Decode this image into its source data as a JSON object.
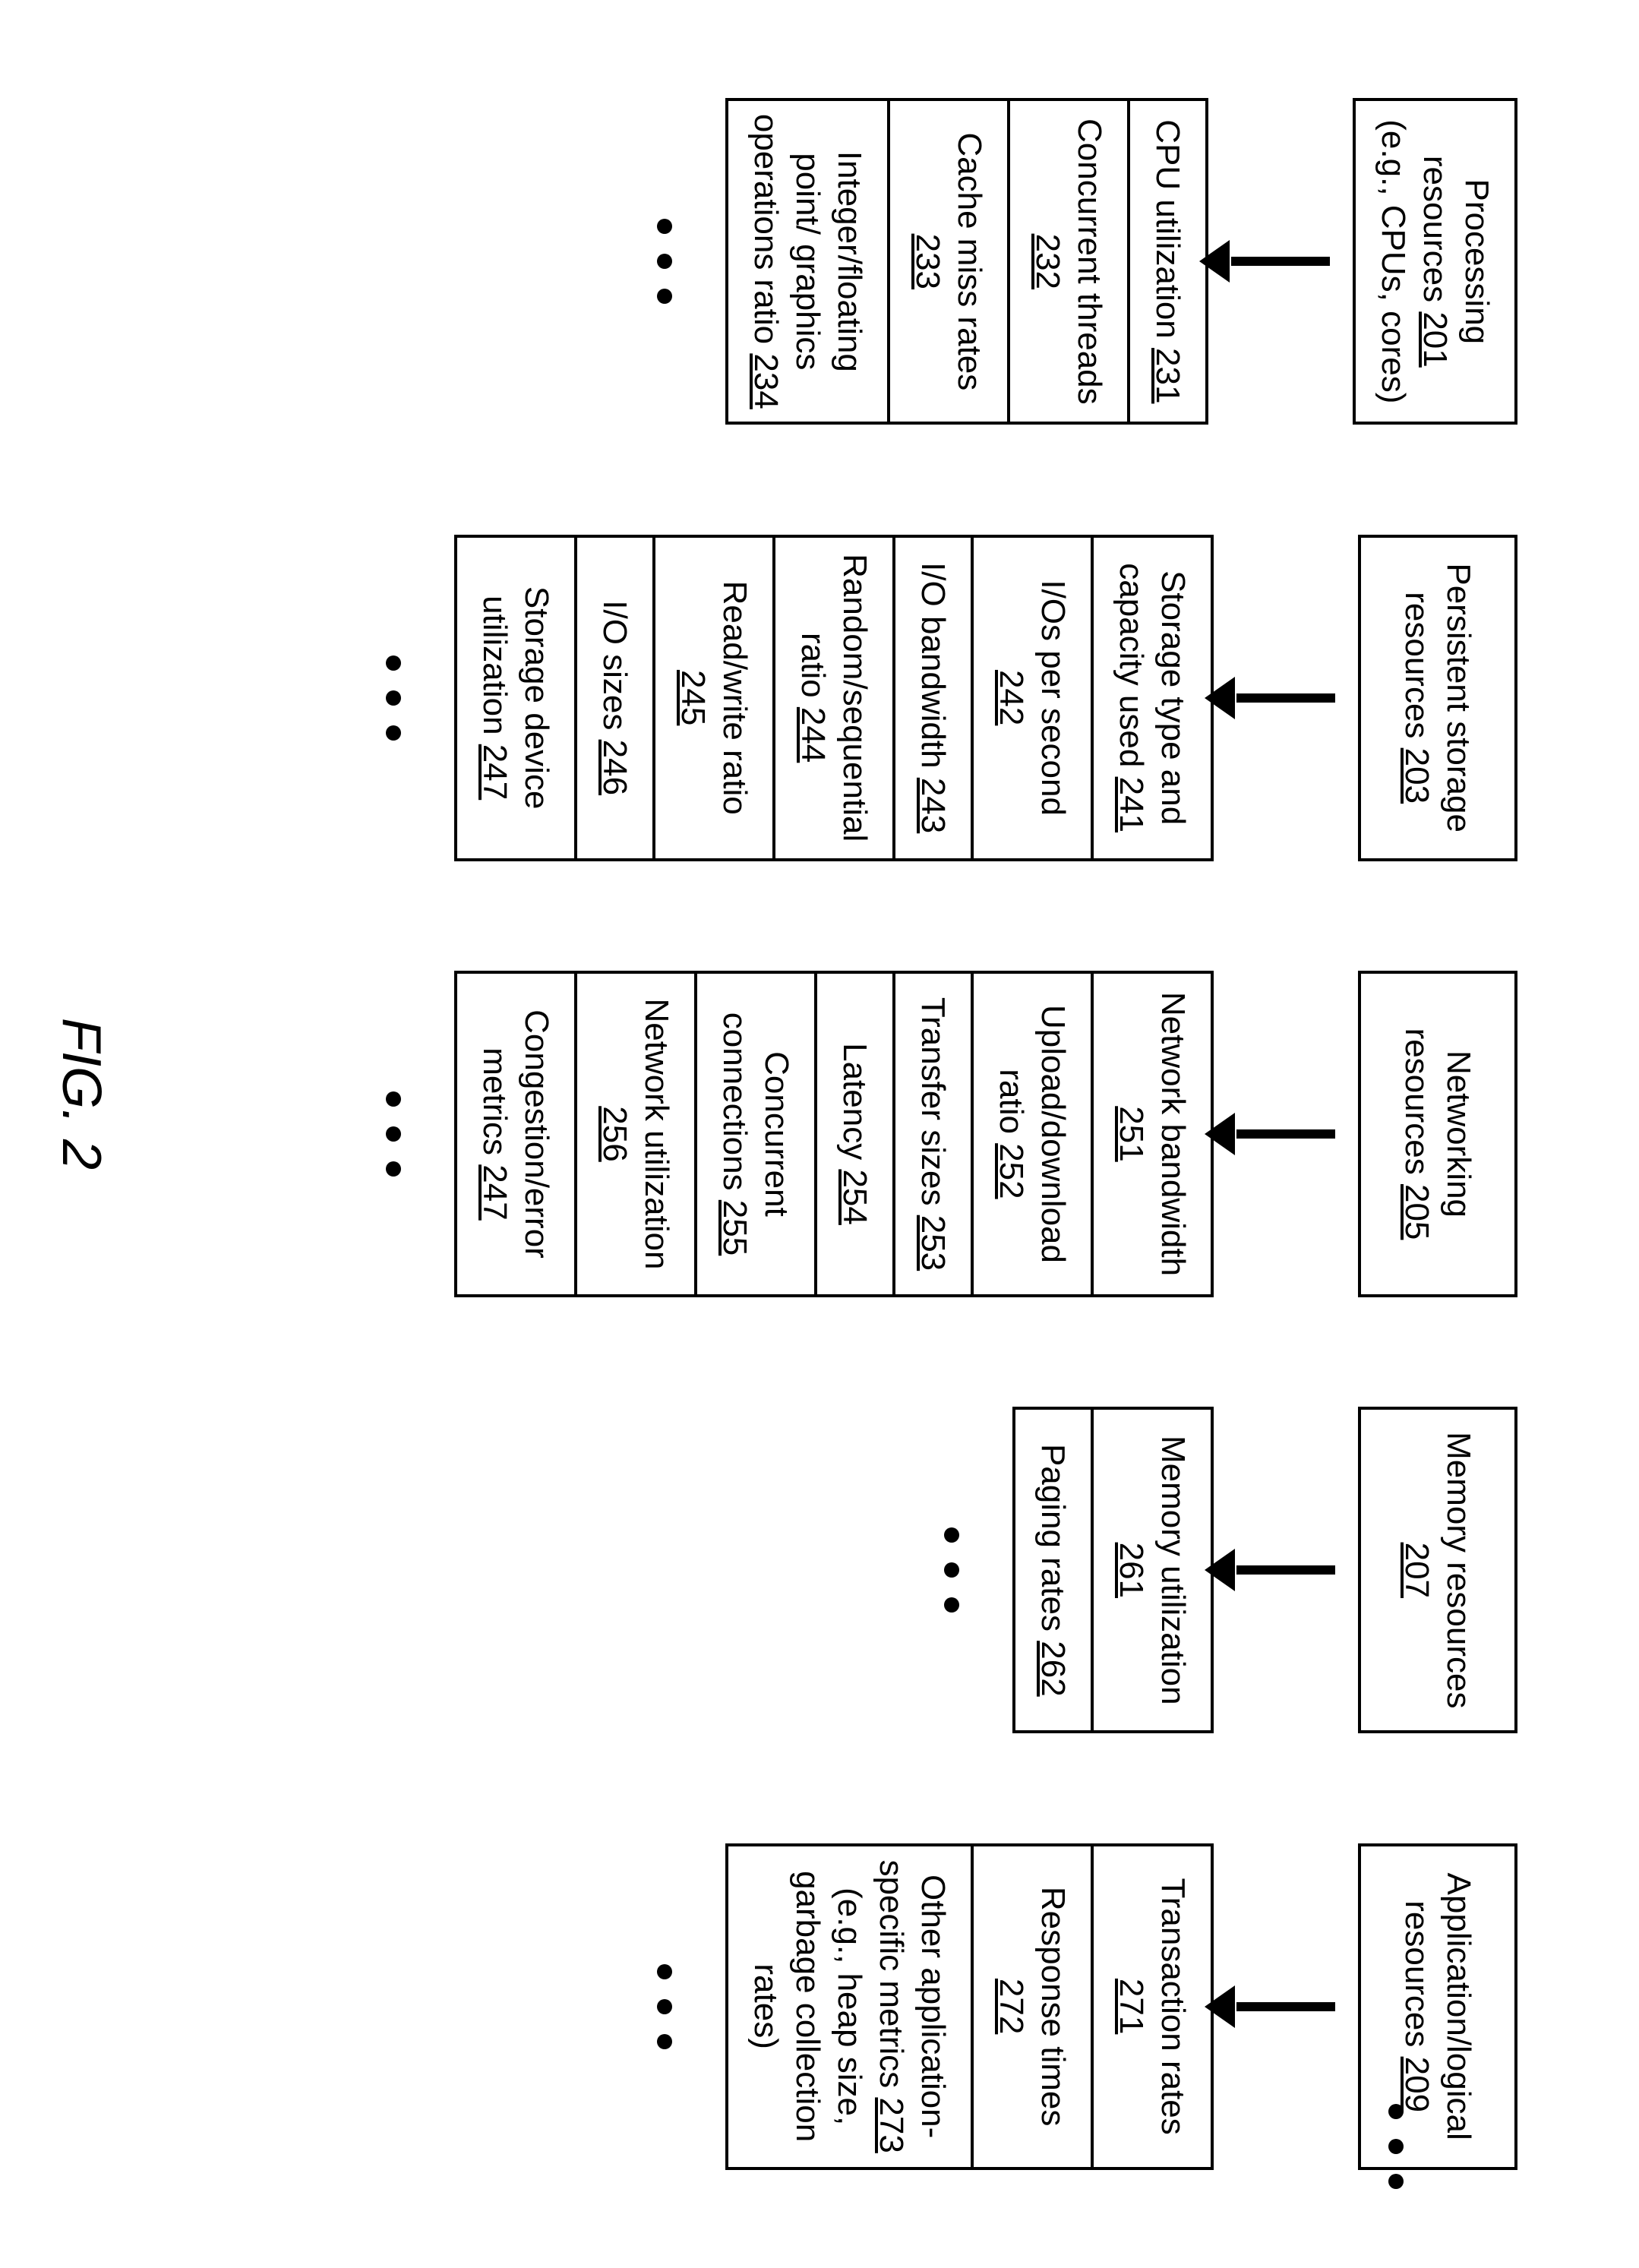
{
  "figure_label": "FIG. 2",
  "ellipsis": "• • •",
  "columns": [
    {
      "header": {
        "text": "Processing resources",
        "ref": "201",
        "suffix": " (e.g., CPUs, cores)"
      },
      "items": [
        {
          "text": "CPU utilization",
          "ref": "231"
        },
        {
          "text": "Concurrent threads",
          "ref": "232"
        },
        {
          "text": "Cache miss rates",
          "ref": "233"
        },
        {
          "text": "Integer/floating point/ graphics operations ratio",
          "ref": "234"
        }
      ]
    },
    {
      "header": {
        "text": "Persistent storage resources",
        "ref": "203"
      },
      "items": [
        {
          "text": "Storage type and capacity used",
          "ref": "241"
        },
        {
          "text": "I/Os per second",
          "ref": "242"
        },
        {
          "text": "I/O bandwidth",
          "ref": "243"
        },
        {
          "text": "Random/sequential ratio",
          "ref": "244"
        },
        {
          "text": "Read/write ratio",
          "ref": "245"
        },
        {
          "text": "I/O sizes",
          "ref": "246"
        },
        {
          "text": "Storage device utilization",
          "ref": "247"
        }
      ]
    },
    {
      "header": {
        "text": "Networking resources",
        "ref": "205"
      },
      "items": [
        {
          "text": "Network bandwidth",
          "ref": "251"
        },
        {
          "text": "Upload/download ratio",
          "ref": "252"
        },
        {
          "text": "Transfer sizes",
          "ref": "253"
        },
        {
          "text": "Latency",
          "ref": "254"
        },
        {
          "text": "Concurrent connections",
          "ref": "255"
        },
        {
          "text": "Network utilization",
          "ref": "256"
        },
        {
          "text": "Congestion/error metrics",
          "ref": "247"
        }
      ]
    },
    {
      "header": {
        "text": "Memory resources",
        "ref": "207"
      },
      "items": [
        {
          "text": "Memory utilization",
          "ref": "261"
        },
        {
          "text": "Paging rates",
          "ref": "262"
        }
      ]
    },
    {
      "header": {
        "text": "Application/logical resources",
        "ref": "209"
      },
      "items": [
        {
          "text": "Transaction rates",
          "ref": "271"
        },
        {
          "text": "Response times",
          "ref": "272"
        },
        {
          "text": "Other application-specific metrics",
          "ref": "273",
          "suffix": " (e.g., heap size, garbage collection rates)"
        }
      ]
    }
  ]
}
